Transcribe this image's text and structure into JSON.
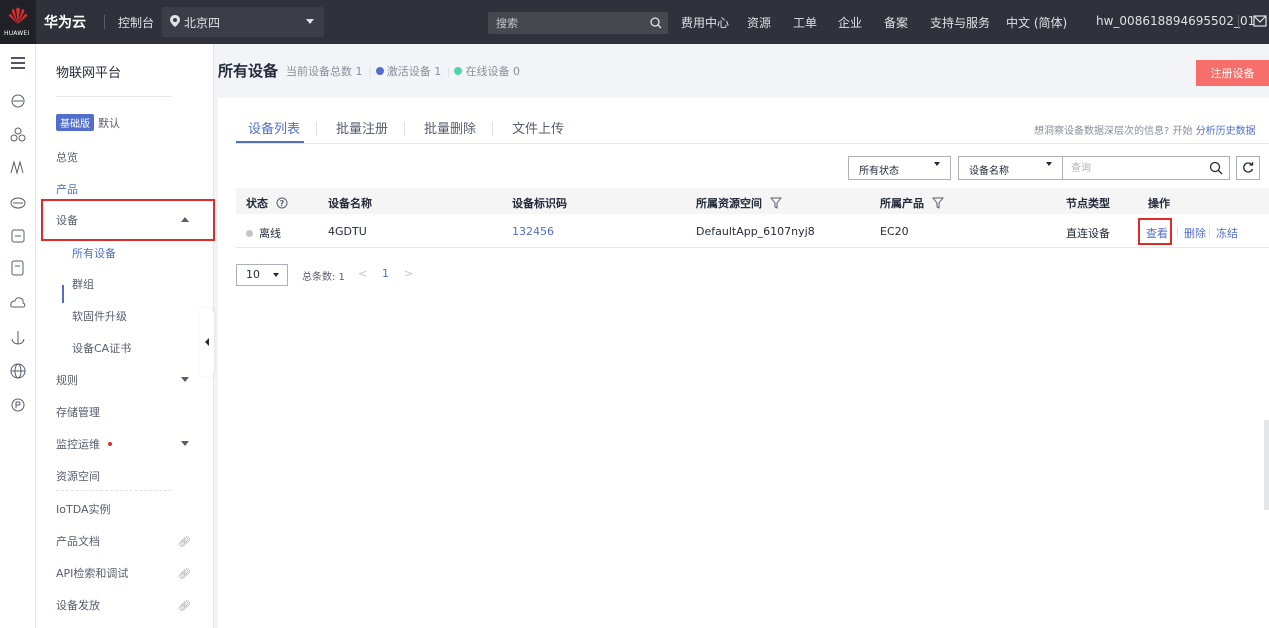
{
  "topbar": {
    "brand": "华为云",
    "logo_sub": "HUAWEI",
    "console": "控制台",
    "region": "北京四",
    "search_placeholder": "搜索",
    "nav": [
      "费用中心",
      "资源",
      "工单",
      "企业",
      "备案",
      "支持与服务",
      "中文 (简体)",
      "hw_008618894695502_01"
    ]
  },
  "sidebar": {
    "title": "物联网平台",
    "edition_badge": "基础版",
    "edition_name": "默认",
    "items": {
      "overview": "总览",
      "product": "产品",
      "device": "设备",
      "all_devices": "所有设备",
      "groups": "群组",
      "firmware": "软固件升级",
      "ca_cert": "设备CA证书",
      "rules": "规则",
      "storage": "存储管理",
      "monitor": "监控运维",
      "resource_space": "资源空间",
      "iotda_instance": "IoTDA实例",
      "product_docs": "产品文档",
      "api_explorer": "API检索和调试",
      "provisioning": "设备发放"
    }
  },
  "header": {
    "title": "所有设备",
    "total_label": "当前设备总数 1",
    "active_label": "激活设备 1",
    "online_label": "在线设备 0",
    "register_button": "注册设备",
    "active_color": "#526ecc",
    "online_color": "#50d4ab"
  },
  "tabs": [
    "设备列表",
    "批量注册",
    "批量删除",
    "文件上传"
  ],
  "insight": {
    "text": "想洞察设备数据深层次的信息? 开始",
    "link": "分析历史数据"
  },
  "filters": {
    "status": "所有状态",
    "field": "设备名称",
    "query_placeholder": "查询"
  },
  "table": {
    "columns": [
      "状态",
      "设备名称",
      "设备标识码",
      "所属资源空间",
      "所属产品",
      "节点类型",
      "操作"
    ],
    "rows": [
      {
        "status": "离线",
        "name": "4GDTU",
        "identifier": "132456",
        "resource_space": "DefaultApp_6107nyj8",
        "product": "EC20",
        "node_type": "直连设备",
        "actions": [
          "查看",
          "删除",
          "冻结"
        ]
      }
    ]
  },
  "pagination": {
    "page_size": "10",
    "total": "总条数: 1",
    "current_page": "1",
    "prev": "<",
    "next": ">"
  },
  "colors": {
    "accent": "#526ecc",
    "highlight": "#e02b2b",
    "register": "#f66f6a",
    "topbar": "#2f323a"
  }
}
